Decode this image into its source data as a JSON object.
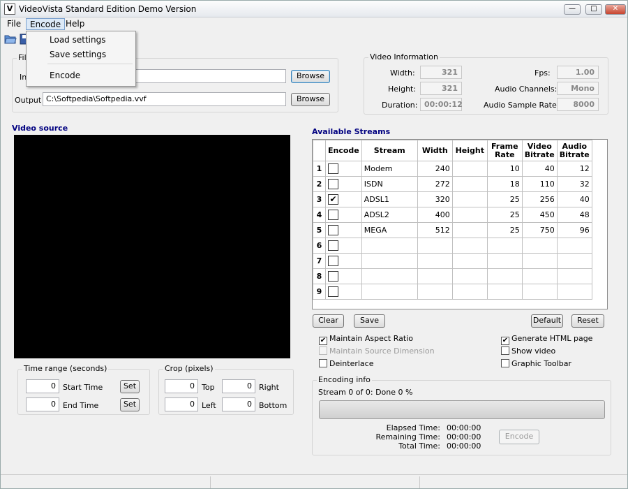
{
  "window": {
    "title": "VideoVista Standard Edition  Demo Version",
    "icon_letter": "V",
    "controls": [
      "minimize",
      "maximize",
      "close"
    ]
  },
  "menu": {
    "items": [
      {
        "label": "File"
      },
      {
        "label": "Encode",
        "active": true
      },
      {
        "label": "Help"
      }
    ],
    "encode_dropdown": [
      "Load settings",
      "Save settings",
      "Encode"
    ]
  },
  "toolbar": {
    "icons": [
      "open-folder-icon",
      "save-icon"
    ]
  },
  "files": {
    "group_label": "Files",
    "input_label": "Input",
    "input_value": "",
    "output_label": "Output",
    "output_value": "C:\\Softpedia\\Softpedia.vvf",
    "browse_label": "Browse"
  },
  "video_info": {
    "group_label": "Video Information",
    "width_label": "Width:",
    "width": "321",
    "height_label": "Height:",
    "height": "321",
    "duration_label": "Duration:",
    "duration": "00:00:12",
    "fps_label": "Fps:",
    "fps": "1.00",
    "channels_label": "Audio Channels:",
    "channels": "Mono",
    "rate_label": "Audio Sample Rate:",
    "rate": "8000"
  },
  "video_source": {
    "title": "Video source"
  },
  "time_range": {
    "group_label": "Time range (seconds)",
    "start_value": "0",
    "start_label": "Start Time",
    "end_value": "0",
    "end_label": "End Time",
    "set_label": "Set"
  },
  "crop": {
    "group_label": "Crop (pixels)",
    "top_value": "0",
    "top_label": "Top",
    "right_value": "0",
    "right_label": "Right",
    "left_value": "0",
    "left_label": "Left",
    "bottom_value": "0",
    "bottom_label": "Bottom"
  },
  "streams": {
    "title": "Available Streams",
    "columns": [
      "Encode",
      "Stream",
      "Width",
      "Height",
      "Frame Rate",
      "Video Bitrate",
      "Audio Bitrate"
    ],
    "rows": [
      {
        "idx": "1",
        "checked": false,
        "stream": "Modem",
        "width": "240",
        "height": "",
        "frame_rate": "10",
        "video_bitrate": "40",
        "audio_bitrate": "12"
      },
      {
        "idx": "2",
        "checked": false,
        "stream": "ISDN",
        "width": "272",
        "height": "",
        "frame_rate": "18",
        "video_bitrate": "110",
        "audio_bitrate": "32"
      },
      {
        "idx": "3",
        "checked": true,
        "stream": "ADSL1",
        "width": "320",
        "height": "",
        "frame_rate": "25",
        "video_bitrate": "256",
        "audio_bitrate": "40"
      },
      {
        "idx": "4",
        "checked": false,
        "stream": "ADSL2",
        "width": "400",
        "height": "",
        "frame_rate": "25",
        "video_bitrate": "450",
        "audio_bitrate": "48"
      },
      {
        "idx": "5",
        "checked": false,
        "stream": "MEGA",
        "width": "512",
        "height": "",
        "frame_rate": "25",
        "video_bitrate": "750",
        "audio_bitrate": "96"
      },
      {
        "idx": "6",
        "checked": false,
        "stream": "",
        "width": "",
        "height": "",
        "frame_rate": "",
        "video_bitrate": "",
        "audio_bitrate": ""
      },
      {
        "idx": "7",
        "checked": false,
        "stream": "",
        "width": "",
        "height": "",
        "frame_rate": "",
        "video_bitrate": "",
        "audio_bitrate": ""
      },
      {
        "idx": "8",
        "checked": false,
        "stream": "",
        "width": "",
        "height": "",
        "frame_rate": "",
        "video_bitrate": "",
        "audio_bitrate": ""
      },
      {
        "idx": "9",
        "checked": false,
        "stream": "",
        "width": "",
        "height": "",
        "frame_rate": "",
        "video_bitrate": "",
        "audio_bitrate": ""
      }
    ],
    "clear_label": "Clear",
    "save_label": "Save",
    "default_label": "Default",
    "reset_label": "Reset"
  },
  "options": {
    "maintain_aspect": {
      "label": "Maintain Aspect Ratio",
      "checked": true
    },
    "maintain_source": {
      "label": "Maintain Source Dimension",
      "checked": false,
      "disabled": true
    },
    "deinterlace": {
      "label": "Deinterlace",
      "checked": false
    },
    "generate_html": {
      "label": "Generate HTML page",
      "checked": true
    },
    "show_video": {
      "label": "Show video",
      "checked": false
    },
    "graphic_toolbar": {
      "label": "Graphic Toolbar",
      "checked": false
    }
  },
  "encoding": {
    "group_label": "Encoding info",
    "status": "Stream 0 of 0: Done 0 %",
    "progress": 0,
    "elapsed_label": "Elapsed Time:",
    "elapsed": "00:00:00",
    "remaining_label": "Remaining Time:",
    "remaining": "00:00:00",
    "total_label": "Total Time:",
    "total": "00:00:00",
    "encode_label": "Encode"
  }
}
